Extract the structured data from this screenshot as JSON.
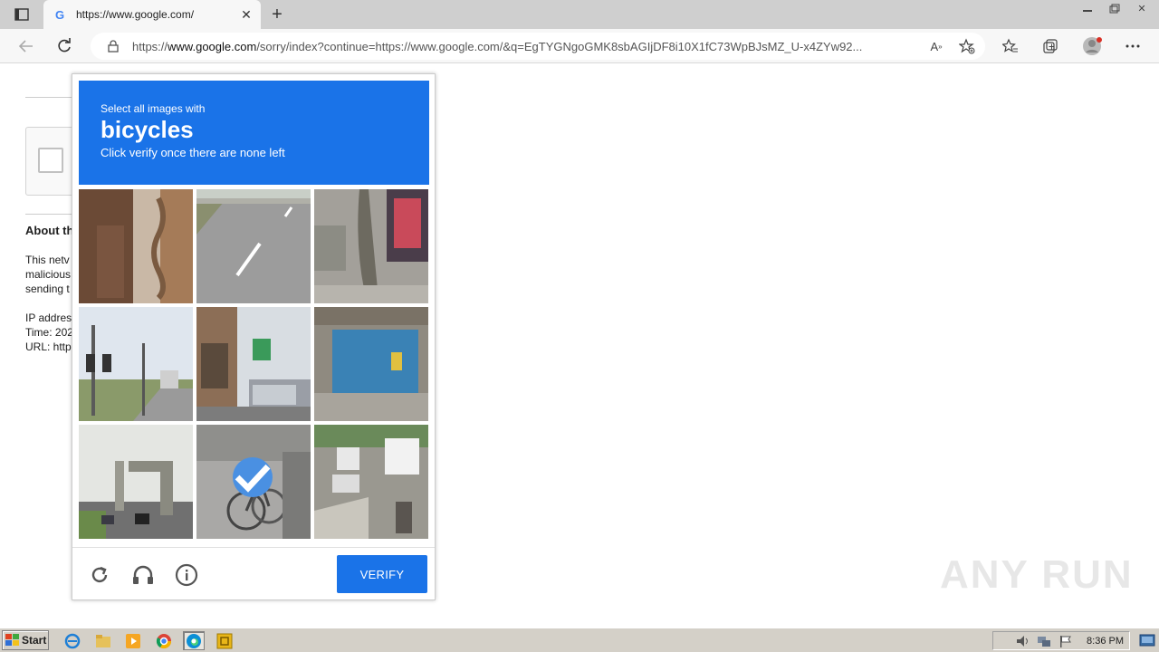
{
  "browser": {
    "tab": {
      "title": "https://www.google.com/",
      "favicon": "G"
    },
    "address": {
      "prefix": "https://",
      "domain": "www.google.com",
      "path": "/sorry/index?continue=https://www.google.com/&q=EgTYGNgoGMK8sbAGIjDF8i10X1fC73WpBJsMZ_U-x4ZYw92..."
    }
  },
  "page": {
    "about_title": "About th",
    "about_lines": [
      "This netv",
      "malicious",
      "sending t",
      "",
      "IP addres",
      "Time: 202",
      "URL: http"
    ]
  },
  "captcha": {
    "pre_text": "Select all images with",
    "object": "bicycles",
    "post_text": "Click verify once there are none left",
    "verify_label": "VERIFY",
    "accent_color": "#1a73e8",
    "selected_tiles": [
      7
    ]
  },
  "watermark": "ANY RUN",
  "taskbar": {
    "start_label": "Start",
    "clock": "8:36 PM"
  }
}
